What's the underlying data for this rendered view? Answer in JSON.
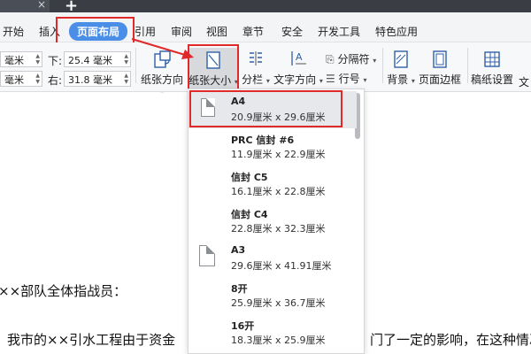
{
  "tabstrip": {
    "close_glyph": "×",
    "plus_glyph": "+"
  },
  "menu": {
    "items": [
      "开始",
      "插入",
      "页面布局",
      "引用",
      "审阅",
      "视图",
      "章节",
      "安全",
      "开发工具",
      "特色应用"
    ]
  },
  "ribbon": {
    "left_top_value": "毫米",
    "left_bottom_value": "毫米",
    "down_label": "下:",
    "down_value": "25.4 毫米",
    "right_label": "右:",
    "right_value": "31.8 毫米",
    "orientation": "纸张方向",
    "size": "纸张大小",
    "columns": "分栏",
    "text_direction": "文字方向",
    "separator": "分隔符",
    "line_numbers": "行号",
    "background": "背景",
    "page_border": "页面边框",
    "paper_settings": "稿纸设置",
    "text_cut": "文"
  },
  "document": {
    "line1": "××部队全体指战员：",
    "line2_left": "我市的××引水工程由于资金",
    "line2_right": "门了一定的影响，在这种情况"
  },
  "dropdown": {
    "options": [
      {
        "name": "A4",
        "dims": "20.9厘米 x 29.6厘米",
        "selected": true,
        "icon": "page-icon"
      },
      {
        "name": "PRC 信封 #6",
        "dims": "11.9厘米 x 22.9厘米"
      },
      {
        "name": "信封 C5",
        "dims": "16.1厘米 x 22.8厘米"
      },
      {
        "name": "信封 C4",
        "dims": "22.8厘米 x 32.3厘米"
      },
      {
        "name": "A3",
        "dims": "29.6厘米 x 41.91厘米",
        "icon": "page-icon"
      },
      {
        "name": "8开",
        "dims": "25.9厘米 x 36.7厘米"
      },
      {
        "name": "16开",
        "dims": "18.3厘米 x 25.9厘米"
      }
    ]
  },
  "colors": {
    "accent": "#4a8ee8",
    "highlight": "#e02a2a",
    "tab_dark": "#3a3d44"
  }
}
